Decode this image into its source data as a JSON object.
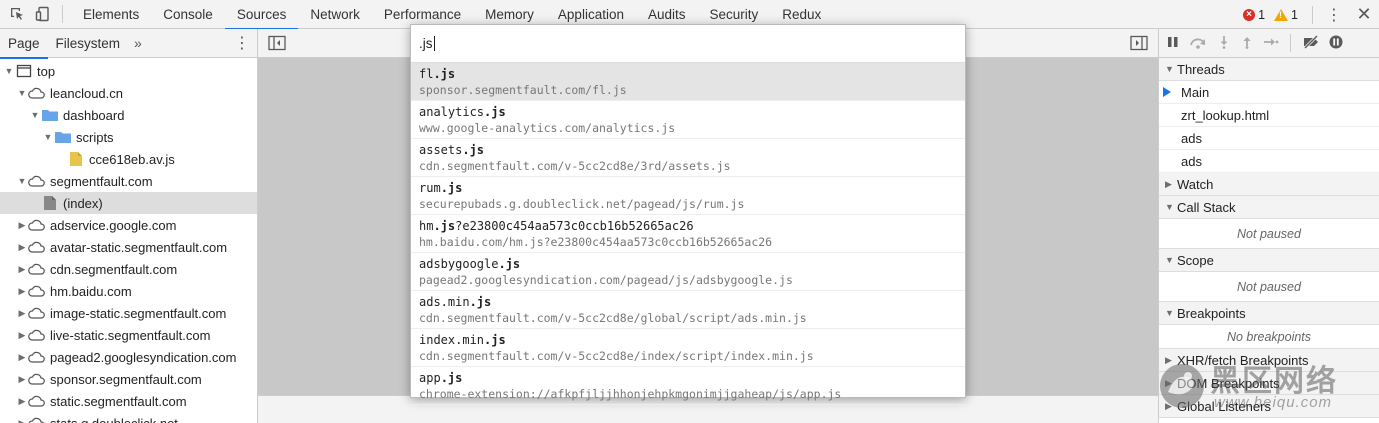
{
  "toolbar": {
    "tabs": [
      "Elements",
      "Console",
      "Sources",
      "Network",
      "Performance",
      "Memory",
      "Application",
      "Audits",
      "Security",
      "Redux"
    ],
    "active_tab": "Sources",
    "errors_count": "1",
    "warnings_count": "1"
  },
  "navigator": {
    "tabs": [
      "Page",
      "Filesystem"
    ],
    "more": "»",
    "tree": [
      {
        "label": "top",
        "depth": 0,
        "arrow": "open",
        "icon": "frame-icon"
      },
      {
        "label": "leancloud.cn",
        "depth": 1,
        "arrow": "open",
        "icon": "cloud-icon"
      },
      {
        "label": "dashboard",
        "depth": 2,
        "arrow": "open",
        "icon": "folder-icon"
      },
      {
        "label": "scripts",
        "depth": 3,
        "arrow": "open",
        "icon": "folder-icon"
      },
      {
        "label": "cce618eb.av.js",
        "depth": 4,
        "arrow": "none",
        "icon": "js-file-icon"
      },
      {
        "label": "segmentfault.com",
        "depth": 1,
        "arrow": "open",
        "icon": "cloud-icon"
      },
      {
        "label": "(index)",
        "depth": 2,
        "arrow": "none",
        "icon": "document-icon",
        "selected": true
      },
      {
        "label": "adservice.google.com",
        "depth": 1,
        "arrow": "closed",
        "icon": "cloud-icon"
      },
      {
        "label": "avatar-static.segmentfault.com",
        "depth": 1,
        "arrow": "closed",
        "icon": "cloud-icon"
      },
      {
        "label": "cdn.segmentfault.com",
        "depth": 1,
        "arrow": "closed",
        "icon": "cloud-icon"
      },
      {
        "label": "hm.baidu.com",
        "depth": 1,
        "arrow": "closed",
        "icon": "cloud-icon"
      },
      {
        "label": "image-static.segmentfault.com",
        "depth": 1,
        "arrow": "closed",
        "icon": "cloud-icon"
      },
      {
        "label": "live-static.segmentfault.com",
        "depth": 1,
        "arrow": "closed",
        "icon": "cloud-icon"
      },
      {
        "label": "pagead2.googlesyndication.com",
        "depth": 1,
        "arrow": "closed",
        "icon": "cloud-icon"
      },
      {
        "label": "sponsor.segmentfault.com",
        "depth": 1,
        "arrow": "closed",
        "icon": "cloud-icon"
      },
      {
        "label": "static.segmentfault.com",
        "depth": 1,
        "arrow": "closed",
        "icon": "cloud-icon"
      },
      {
        "label": "stats.g.doubleclick.net",
        "depth": 1,
        "arrow": "closed",
        "icon": "cloud-icon"
      }
    ]
  },
  "quick_open": {
    "query": ".js",
    "items": [
      {
        "pre": "fl",
        "bold": ".js",
        "post": "",
        "url": "sponsor.segmentfault.com/fl.js",
        "selected": true
      },
      {
        "pre": "analytics",
        "bold": ".js",
        "post": "",
        "url": "www.google-analytics.com/analytics.js"
      },
      {
        "pre": "assets",
        "bold": ".js",
        "post": "",
        "url": "cdn.segmentfault.com/v-5cc2cd8e/3rd/assets.js"
      },
      {
        "pre": "rum",
        "bold": ".js",
        "post": "",
        "url": "securepubads.g.doubleclick.net/pagead/js/rum.js"
      },
      {
        "pre": "hm",
        "bold": ".js",
        "post": "?e23800c454aa573c0ccb16b52665ac26",
        "url": "hm.baidu.com/hm.js?e23800c454aa573c0ccb16b52665ac26"
      },
      {
        "pre": "adsbygoogle",
        "bold": ".js",
        "post": "",
        "url": "pagead2.googlesyndication.com/pagead/js/adsbygoogle.js"
      },
      {
        "pre": "ads.min",
        "bold": ".js",
        "post": "",
        "url": "cdn.segmentfault.com/v-5cc2cd8e/global/script/ads.min.js"
      },
      {
        "pre": "index.min",
        "bold": ".js",
        "post": "",
        "url": "cdn.segmentfault.com/v-5cc2cd8e/index/script/index.min.js"
      },
      {
        "pre": "app",
        "bold": ".js",
        "post": "",
        "url": "chrome-extension://afkpfjljjhhonjehpkmgonimjjgaheap/js/app.js"
      }
    ]
  },
  "debugger": {
    "threads_label": "Threads",
    "threads": [
      "Main",
      "zrt_lookup.html",
      "ads",
      "ads"
    ],
    "watch_label": "Watch",
    "callstack_label": "Call Stack",
    "callstack_empty": "Not paused",
    "scope_label": "Scope",
    "scope_empty": "Not paused",
    "breakpoints_label": "Breakpoints",
    "breakpoints_empty": "No breakpoints",
    "xhr_label": "XHR/fetch Breakpoints",
    "dom_label": "DOM Breakpoints",
    "listeners_label": "Global Listeners"
  },
  "watermark": {
    "brand": "黑区网络",
    "url": "www.heiqu.com"
  }
}
